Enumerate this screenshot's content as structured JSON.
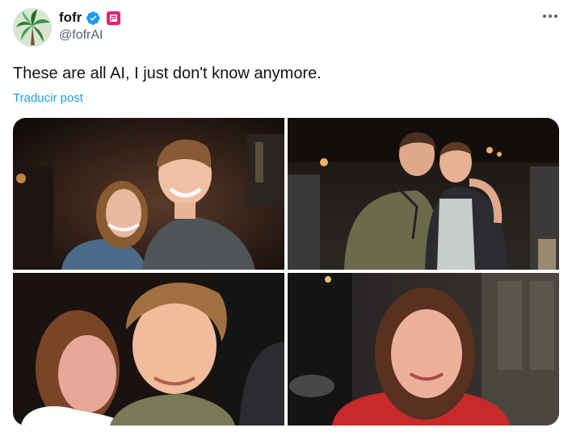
{
  "author": {
    "display_name": "fofr",
    "handle": "@fofrAI",
    "avatar_icon": "palm-tree-avatar",
    "verified_icon": "verified-badge-icon",
    "affiliate_icon": "affiliate-badge-icon"
  },
  "menu_icon": "more-options-icon",
  "tweet": {
    "text": "These are all AI, I just don't know anymore.",
    "translate_label": "Traducir post"
  },
  "colors": {
    "link": "#1d9bf0",
    "verified": "#1d9bf0",
    "affiliate_badge": "#e8206b",
    "secondary_text": "#536471"
  }
}
